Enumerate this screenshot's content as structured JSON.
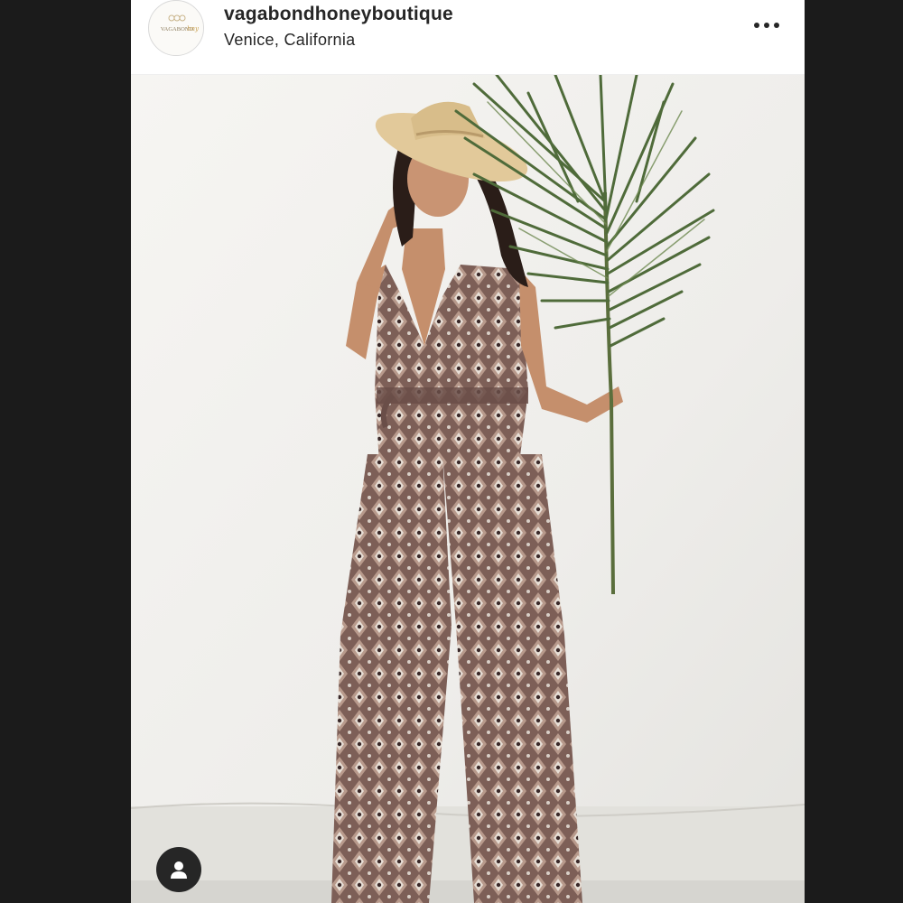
{
  "post": {
    "username": "vagabondhoneyboutique",
    "location": "Venice, California",
    "avatar": {
      "icon": "brand-logo-icon",
      "logo_text": "VAGABOND honey"
    },
    "more_icon": "more-horizontal-icon",
    "photo": {
      "alt": "model in patterned jumpsuit and straw hat holding palm frond"
    },
    "tag_icon": "user-tag-icon"
  },
  "colors": {
    "frame": "#1b1b1b",
    "header_bg": "#ffffff",
    "text": "#262626",
    "wall": "#f2f1ee",
    "hat": "#e2c99a",
    "jumpsuit": "#8a6a5e",
    "palm": "#4f6b3a"
  }
}
